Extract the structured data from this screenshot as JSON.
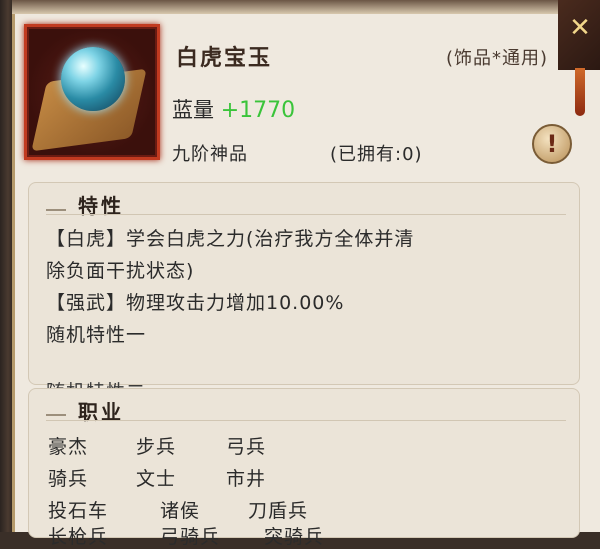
{
  "item": {
    "name": "白虎宝玉",
    "type": "(饰品*通用)",
    "mana_label": "蓝量",
    "mana_value": "+1770",
    "rank": "九阶神品",
    "owned": "(已拥有:0)"
  },
  "buttons": {
    "info": "!",
    "close": "✕"
  },
  "traits": {
    "title": "特性",
    "lines": [
      "【白虎】学会白虎之力(治疗我方全体并清",
      "除负面干扰状态)",
      "【强武】物理攻击力增加10.00%",
      "随机特性一",
      "随机特性二"
    ]
  },
  "jobs": {
    "title": "职业",
    "rows": [
      [
        "豪杰",
        "步兵",
        "弓兵"
      ],
      [
        "骑兵",
        "文士",
        "市井"
      ],
      [
        "投石车",
        "诸侯",
        "刀盾兵"
      ],
      [
        "长枪兵",
        "弓骑兵",
        "突骑兵"
      ]
    ]
  }
}
